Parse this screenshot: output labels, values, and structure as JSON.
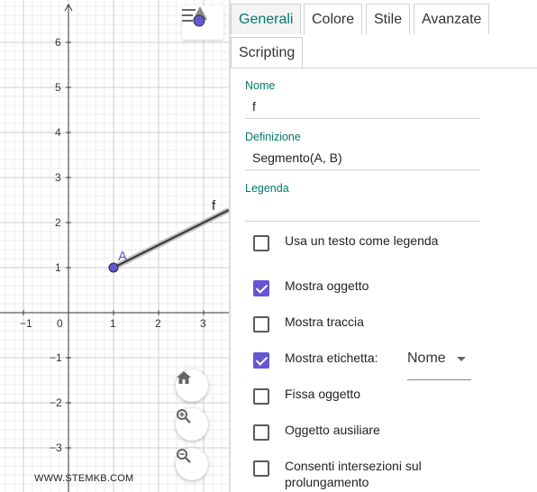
{
  "graphics": {
    "x_ticks": [
      "−1",
      "0",
      "1",
      "2",
      "3"
    ],
    "y_ticks": [
      "6",
      "5",
      "4",
      "3",
      "2",
      "1",
      "−1",
      "−2",
      "−3"
    ],
    "point_label": "A",
    "segment_label": "f",
    "point_color": "#6557d2",
    "watermark": "WWW.STEMKB.COM"
  },
  "tabs": {
    "generali": "Generali",
    "colore": "Colore",
    "stile": "Stile",
    "avanzate": "Avanzate",
    "scripting": "Scripting"
  },
  "fields": {
    "nome_label": "Nome",
    "nome_value": "f",
    "definizione_label": "Definizione",
    "definizione_value": "Segmento(A, B)",
    "legenda_label": "Legenda",
    "legenda_value": ""
  },
  "checkboxes": {
    "usa_testo": "Usa un testo come legenda",
    "mostra_oggetto": "Mostra oggetto",
    "mostra_traccia": "Mostra traccia",
    "mostra_etichetta": "Mostra etichetta:",
    "fissa_oggetto": "Fissa oggetto",
    "oggetto_ausiliare": "Oggetto ausiliare",
    "consenti_line1": "Consenti intersezioni sul",
    "consenti_line2": "prolungamento"
  },
  "label_dropdown": {
    "selected": "Nome"
  },
  "colors": {
    "accent": "#00796b",
    "checkbox_checked": "#6557d2"
  }
}
